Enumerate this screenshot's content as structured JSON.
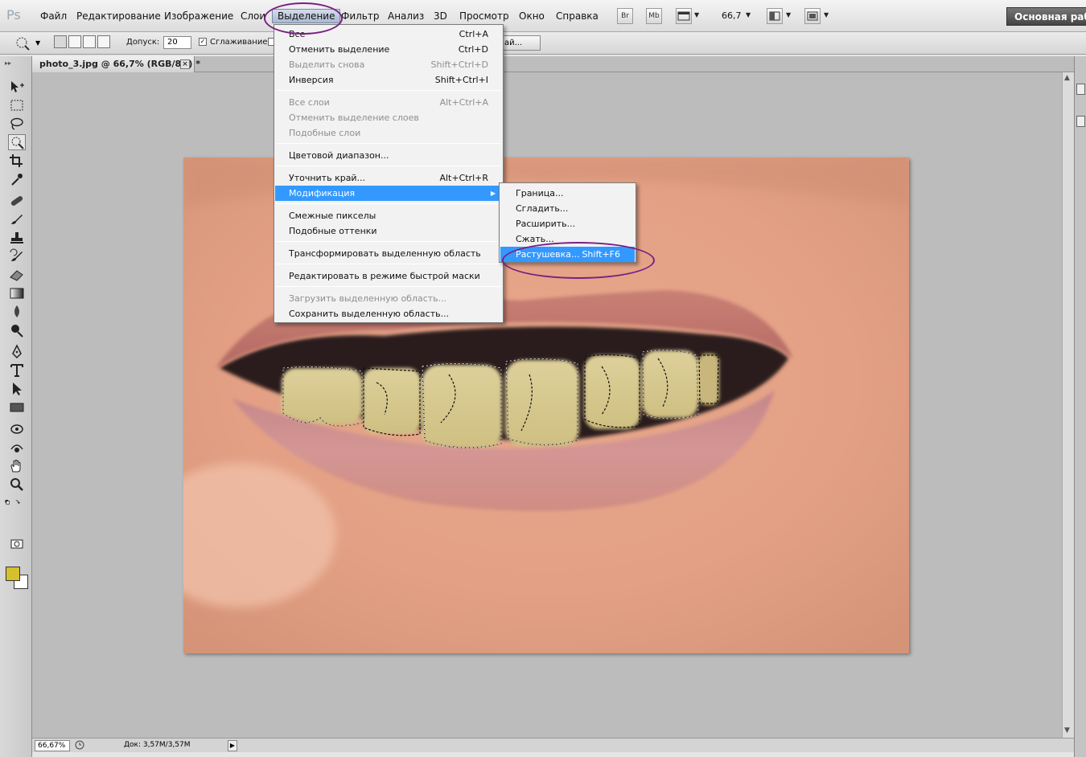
{
  "app": {
    "logo": "Ps"
  },
  "menubar": {
    "items": [
      "Файл",
      "Редактирование",
      "Изображение",
      "Слои",
      "Выделение",
      "Фильтр",
      "Анализ",
      "3D",
      "Просмотр",
      "Окно",
      "Справка"
    ],
    "bridge": "Br",
    "minibridge": "Mb",
    "zoom": "66,7",
    "workspace": "Основная рабочая среда"
  },
  "options": {
    "tolerance_label": "Допуск:",
    "tolerance_value": "20",
    "antialias_label": "Сглаживание",
    "antialias_checked": "✓",
    "refine_fragment": "ай..."
  },
  "document": {
    "tab_title": "photo_3.jpg @ 66,7% (RGB/8#) *",
    "close_glyph": "×"
  },
  "status": {
    "zoom": "66,67%",
    "doc_info": "Док: 3,57M/3,57M"
  },
  "colors": {
    "foreground": "#d4c12d",
    "background": "#ffffff",
    "highlight": "#3399ff",
    "annotation": "#7a1f84"
  },
  "select_menu": {
    "groups": [
      [
        {
          "label": "Все",
          "shortcut": "Ctrl+A",
          "disabled": false
        },
        {
          "label": "Отменить выделение",
          "shortcut": "Ctrl+D",
          "disabled": false
        },
        {
          "label": "Выделить снова",
          "shortcut": "Shift+Ctrl+D",
          "disabled": true
        },
        {
          "label": "Инверсия",
          "shortcut": "Shift+Ctrl+I",
          "disabled": false
        }
      ],
      [
        {
          "label": "Все слои",
          "shortcut": "Alt+Ctrl+A",
          "disabled": true
        },
        {
          "label": "Отменить выделение слоев",
          "shortcut": "",
          "disabled": true
        },
        {
          "label": "Подобные слои",
          "shortcut": "",
          "disabled": true
        }
      ],
      [
        {
          "label": "Цветовой диапазон...",
          "shortcut": "",
          "disabled": false
        }
      ],
      [
        {
          "label": "Уточнить край...",
          "shortcut": "Alt+Ctrl+R",
          "disabled": false
        },
        {
          "label": "Модификация",
          "shortcut": "",
          "disabled": false
        }
      ],
      [
        {
          "label": "Смежные пикселы",
          "shortcut": "",
          "disabled": false
        },
        {
          "label": "Подобные оттенки",
          "shortcut": "",
          "disabled": false
        }
      ],
      [
        {
          "label": "Трансформировать выделенную область",
          "shortcut": "",
          "disabled": false
        }
      ],
      [
        {
          "label": "Редактировать в режиме быстрой маски",
          "shortcut": "",
          "disabled": false
        }
      ],
      [
        {
          "label": "Загрузить выделенную область...",
          "shortcut": "",
          "disabled": true
        },
        {
          "label": "Сохранить выделенную область...",
          "shortcut": "",
          "disabled": false
        }
      ]
    ],
    "submenu_arrow": "▶"
  },
  "modify_submenu": {
    "items": [
      {
        "label": "Граница...",
        "shortcut": ""
      },
      {
        "label": "Сгладить...",
        "shortcut": ""
      },
      {
        "label": "Расширить...",
        "shortcut": ""
      },
      {
        "label": "Сжать...",
        "shortcut": ""
      },
      {
        "label": "Растушевка...",
        "shortcut": "Shift+F6"
      }
    ]
  }
}
